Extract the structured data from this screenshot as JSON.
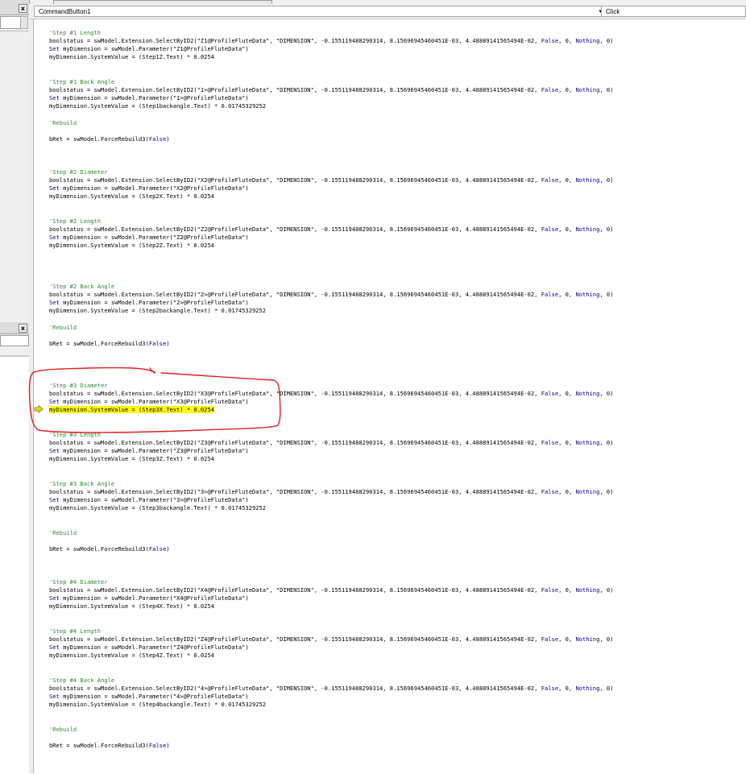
{
  "window": {
    "left_panel": {
      "close1": "x",
      "close2": "x"
    }
  },
  "combos": {
    "object": "CommandButton1",
    "procedure": "Click",
    "arrow_glyph": "▾"
  },
  "colors": {
    "comment": "#2e8b2e",
    "keyword": "#00008b",
    "highlight": "#ffff00",
    "annotation": "#e02020",
    "execution_arrow": "#e8c800"
  },
  "execution_marker_icon": "execution-point-arrow",
  "code": {
    "l01": "'Step #1 Length",
    "l02a": "boolstatus = swModel.Extension.SelectByID2(\"Z1@ProfileFluteData\", \"DIMENSION\", -0.155119488290314, 8.15696945460451E-03, 4.48889141565494E-02, ",
    "l02b": "False",
    "l02c": ", 0, ",
    "l02d": "Nothing",
    "l02e": ", 0)",
    "l03a": "Set",
    "l03b": " myDimension = swModel.Parameter(\"Z1@ProfileFluteData\")",
    "l04": "myDimension.SystemValue = (Step1Z.Text) * 0.0254",
    "l05": "'Step #1 Back Angle",
    "l06a": "boolstatus = swModel.Extension.SelectByID2(\"1>@ProfileFluteData\", \"DIMENSION\", -0.155119488290314, 8.15696945460451E-03, 4.48889141565494E-02, ",
    "l07b": " myDimension = swModel.Parameter(\"1>@ProfileFluteData\")",
    "l08": "myDimension.SystemValue = (Step1backangle.Text) * 0.01745329252",
    "rebuild_comment": "'Rebuild",
    "rebuild_a": "bRet = swModel.ForceRebuild3(",
    "rebuild_b": "False",
    "rebuild_c": ")",
    "l11": "'Step #2 Diameter",
    "l12a": "boolstatus = swModel.Extension.SelectByID2(\"X2@ProfileFluteData\", \"DIMENSION\", -0.155119488290314, 8.15696945460451E-03, 4.48889141565494E-02, ",
    "l13b": " myDimension = swModel.Parameter(\"X2@ProfileFluteData\")",
    "l14": "myDimension.SystemValue = (Step2X.Text) * 0.0254",
    "l15": "'Step #2 Length",
    "l16a": "boolstatus = swModel.Extension.SelectByID2(\"Z2@ProfileFluteData\", \"DIMENSION\", -0.155119488290314, 8.15696945460451E-03, 4.48889141565494E-02, ",
    "l17b": " myDimension = swModel.Parameter(\"Z2@ProfileFluteData\")",
    "l18": "myDimension.SystemValue = (Step2Z.Text) * 0.0254",
    "l19": "'Step #2 Back Angle",
    "l20a": "boolstatus = swModel.Extension.SelectByID2(\"2>@ProfileFluteData\", \"DIMENSION\", -0.155119488290314, 8.15696945460451E-03, 4.48889141565494E-02, ",
    "l21b": " myDimension = swModel.Parameter(\"2>@ProfileFluteData\")",
    "l22": "myDimension.SystemValue = (Step2backangle.Text) * 0.01745329252",
    "l23": "'Step #3 Diameter",
    "l24a": "boolstatus = swModel.Extension.SelectByID2(\"X3@ProfileFluteData\", \"DIMENSION\", -0.155119488290314, 8.15696945460451E-03, 4.48889141565494E-02, ",
    "l25b": " myDimension = swModel.Parameter(\"X3@ProfileFluteData\")",
    "l26": "myDimension.SystemValue = (Step3X.Text) * 0.0254",
    "l27": "'Step #3 Length",
    "l28a": "boolstatus = swModel.Extension.SelectByID2(\"Z3@ProfileFluteData\", \"DIMENSION\", -0.155119488290314, 8.15696945460451E-03, 4.48889141565494E-02, ",
    "l29b": " myDimension = swModel.Parameter(\"Z3@ProfileFluteData\")",
    "l30": "myDimension.SystemValue = (Step3Z.Text) * 0.0254",
    "l31": "'Step #3 Back Angle",
    "l32a": "boolstatus = swModel.Extension.SelectByID2(\"3>@ProfileFluteData\", \"DIMENSION\", -0.155119488290314, 8.15696945460451E-03, 4.48889141565494E-02, ",
    "l33b": " myDimension = swModel.Parameter(\"3>@ProfileFluteData\")",
    "l34": "myDimension.SystemValue = (Step3backangle.Text) * 0.01745329252",
    "l35": "'Step #4 Diameter",
    "l36a": "boolstatus = swModel.Extension.SelectByID2(\"X4@ProfileFluteData\", \"DIMENSION\", -0.155119488290314, 8.15696945460451E-03, 4.48889141565494E-02, ",
    "l37b": " myDimension = swModel.Parameter(\"X4@ProfileFluteData\")",
    "l38": "myDimension.SystemValue = (Step4X.Text) * 0.0254",
    "l39": "'Step #4 Length",
    "l40a": "boolstatus = swModel.Extension.SelectByID2(\"Z4@ProfileFluteData\", \"DIMENSION\", -0.155119488290314, 8.15696945460451E-03, 4.48889141565494E-02, ",
    "l41b": " myDimension = swModel.Parameter(\"Z4@ProfileFluteData\")",
    "l42": "myDimension.SystemValue = (Step4Z.Text) * 0.0254",
    "l43": "'Step #4 Back Angle",
    "l44a": "boolstatus = swModel.Extension.SelectByID2(\"4>@ProfileFluteData\", \"DIMENSION\", -0.155119488290314, 8.15696945460451E-03, 4.48889141565494E-02, ",
    "l45b": " myDimension = swModel.Parameter(\"4>@ProfileFluteData\")",
    "l46": "myDimension.SystemValue = (Step4backangle.Text) * 0.01745329252"
  }
}
